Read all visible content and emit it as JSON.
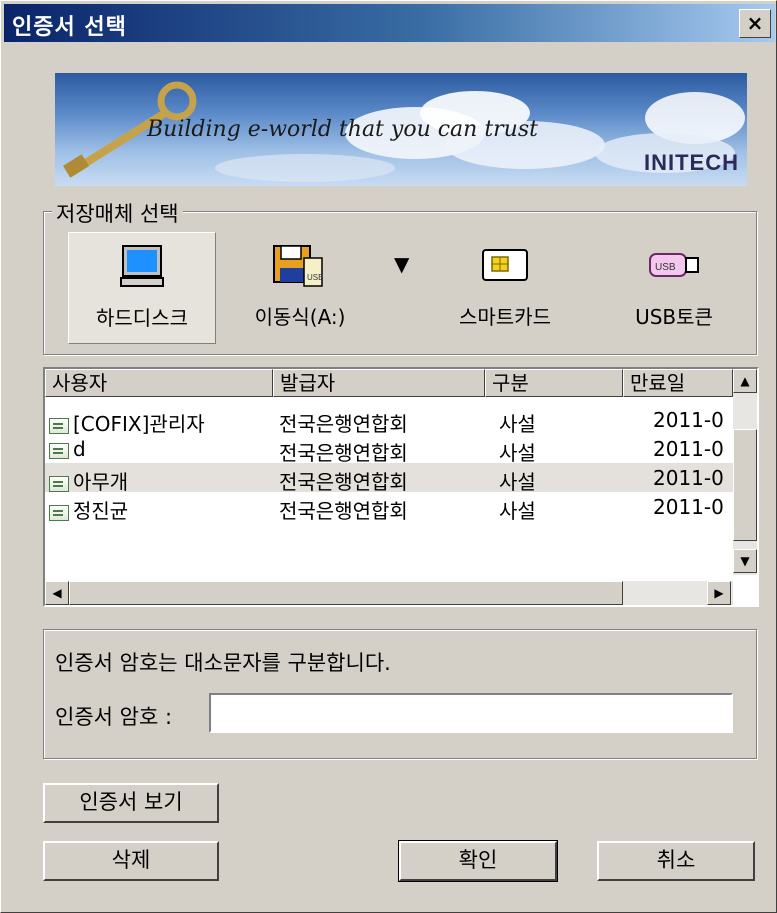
{
  "window": {
    "title": "인증서 선택",
    "close_glyph": "×"
  },
  "banner": {
    "tagline": "Building e-world that you can trust",
    "brand": "INITECH"
  },
  "storage": {
    "legend": "저장매체 선택",
    "items": [
      {
        "label": "하드디스크",
        "icon": "computer-icon",
        "selected": true
      },
      {
        "label": "이동식(A:)",
        "icon": "floppy-icon",
        "selected": false
      },
      {
        "label": "스마트카드",
        "icon": "smartcard-icon",
        "selected": false
      },
      {
        "label": "USB토큰",
        "icon": "usb-token-icon",
        "selected": false
      }
    ],
    "dropdown_glyph": "▼"
  },
  "cert_list": {
    "columns": [
      "사용자",
      "발급자",
      "구분",
      "만료일"
    ],
    "rows": [
      {
        "user": "[COFIX]관리자",
        "issuer": "전국은행연합회",
        "type": "사설",
        "expiry": "2011-0"
      },
      {
        "user": "d",
        "issuer": "전국은행연합회",
        "type": "사설",
        "expiry": "2011-0"
      },
      {
        "user": "아무개",
        "issuer": "전국은행연합회",
        "type": "사설",
        "expiry": "2011-0"
      },
      {
        "user": "정진균",
        "issuer": "전국은행연합회",
        "type": "사설",
        "expiry": "2011-0"
      }
    ],
    "selected_row": 2
  },
  "password": {
    "notice": "인증서 암호는 대소문자를 구분합니다.",
    "label": "인증서 암호 :",
    "value": ""
  },
  "buttons": {
    "view": "인증서 보기",
    "delete": "삭제",
    "ok": "확인",
    "cancel": "취소"
  }
}
